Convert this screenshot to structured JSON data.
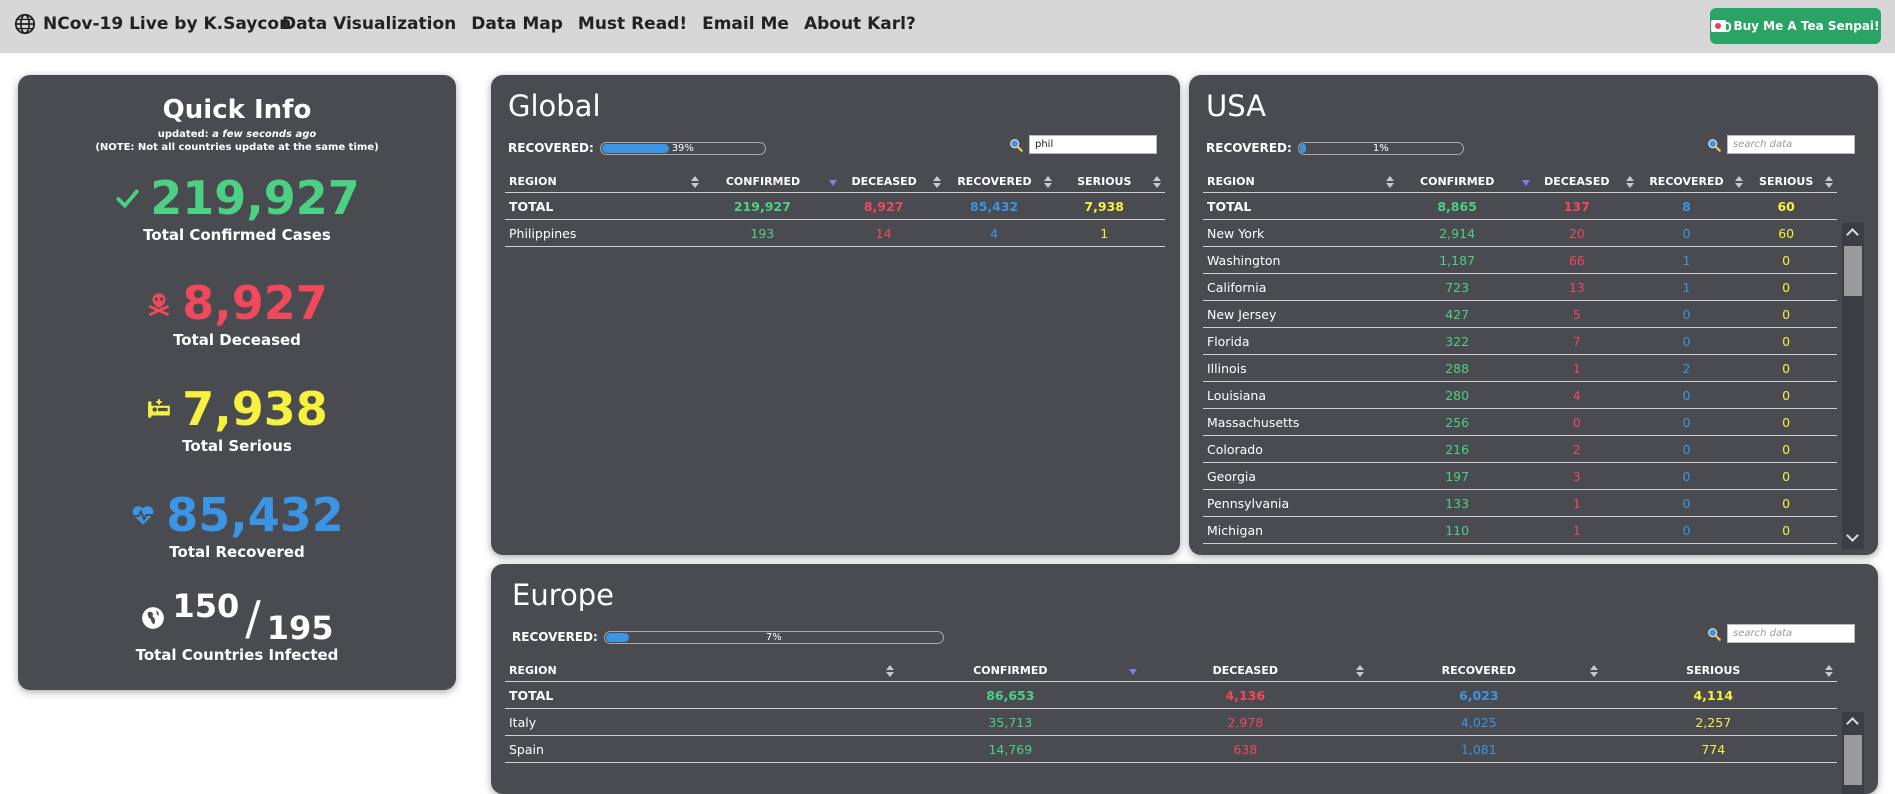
{
  "nav": {
    "brand": "NCov-19 Live by K.Saycon",
    "links": [
      "Data Visualization",
      "Data Map",
      "Must Read!",
      "Email Me",
      "About Karl?"
    ],
    "tea_button": "Buy Me A Tea Senpai!"
  },
  "quick_info": {
    "title": "Quick Info",
    "updated_prefix": "updated:",
    "updated_value": "a few seconds ago",
    "note": "(NOTE: Not all countries update at the same time)",
    "confirmed": {
      "value": "219,927",
      "label": "Total Confirmed Cases"
    },
    "deceased": {
      "value": "8,927",
      "label": "Total Deceased"
    },
    "serious": {
      "value": "7,938",
      "label": "Total Serious"
    },
    "recovered": {
      "value": "85,432",
      "label": "Total Recovered"
    },
    "countries": {
      "infected": "150",
      "total": "195",
      "slash": "/",
      "label": "Total Countries Infected"
    }
  },
  "headers": [
    "REGION",
    "CONFIRMED",
    "DECEASED",
    "RECOVERED",
    "SERIOUS"
  ],
  "recovered_label": "RECOVERED:",
  "global": {
    "title": "Global",
    "recovered_pct": 39,
    "recovered_text": "39%",
    "search_value": "phil",
    "search_placeholder": "search data",
    "total": [
      "TOTAL",
      "219,927",
      "8,927",
      "85,432",
      "7,938"
    ],
    "rows": [
      [
        "Philippines",
        "193",
        "14",
        "4",
        "1"
      ]
    ]
  },
  "usa": {
    "title": "USA",
    "recovered_pct": 1,
    "recovered_text": "1%",
    "search_placeholder": "search data",
    "total": [
      "TOTAL",
      "8,865",
      "137",
      "8",
      "60"
    ],
    "rows": [
      [
        "New York",
        "2,914",
        "20",
        "0",
        "60"
      ],
      [
        "Washington",
        "1,187",
        "66",
        "1",
        "0"
      ],
      [
        "California",
        "723",
        "13",
        "1",
        "0"
      ],
      [
        "New Jersey",
        "427",
        "5",
        "0",
        "0"
      ],
      [
        "Florida",
        "322",
        "7",
        "0",
        "0"
      ],
      [
        "Illinois",
        "288",
        "1",
        "2",
        "0"
      ],
      [
        "Louisiana",
        "280",
        "4",
        "0",
        "0"
      ],
      [
        "Massachusetts",
        "256",
        "0",
        "0",
        "0"
      ],
      [
        "Colorado",
        "216",
        "2",
        "0",
        "0"
      ],
      [
        "Georgia",
        "197",
        "3",
        "0",
        "0"
      ],
      [
        "Pennsylvania",
        "133",
        "1",
        "0",
        "0"
      ],
      [
        "Michigan",
        "110",
        "1",
        "0",
        "0"
      ]
    ]
  },
  "europe": {
    "title": "Europe",
    "recovered_pct": 7,
    "recovered_text": "7%",
    "search_placeholder": "search data",
    "total": [
      "TOTAL",
      "86,653",
      "4,136",
      "6,023",
      "4,114"
    ],
    "rows": [
      [
        "Italy",
        "35,713",
        "2,978",
        "4,025",
        "2,257"
      ],
      [
        "Spain",
        "14,769",
        "638",
        "1,081",
        "774"
      ]
    ]
  },
  "colors": {
    "confirmed": "#4cd083",
    "deceased": "#f0495b",
    "recovered": "#3b95e4",
    "serious": "#f6f03e",
    "card_bg": "#494b50",
    "navbar_bg": "#d7d7d7",
    "tea_button": "#29a464"
  }
}
